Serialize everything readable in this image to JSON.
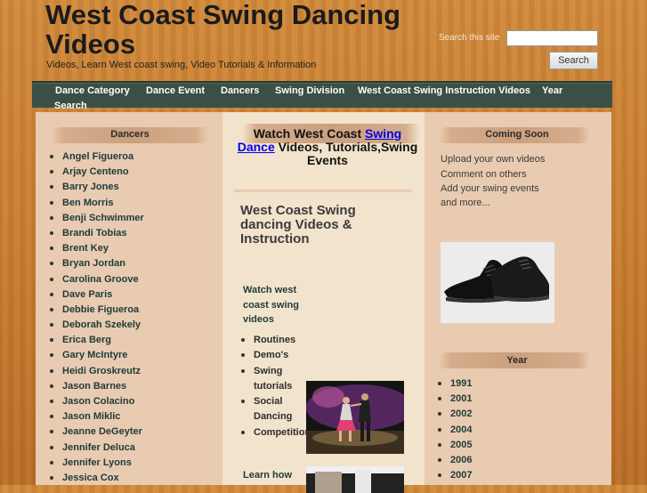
{
  "header": {
    "site_title": "West Coast Swing Dancing Videos",
    "tagline": "Videos, Learn West coast swing, Video Tutorials & Information",
    "search_label": "Search this site",
    "search_value": "",
    "search_button": "Search"
  },
  "nav": {
    "items": [
      "Dance Category",
      "Dance Event",
      "Dancers",
      "Swing Division",
      "West Coast Swing Instruction Videos",
      "Year",
      "Search"
    ]
  },
  "left_sidebar": {
    "heading": "Dancers",
    "dancers": [
      "Angel Figueroa",
      "Arjay Centeno",
      "Barry Jones",
      "Ben Morris",
      "Benji Schwimmer",
      "Brandi Tobias",
      "Brent Key",
      "Bryan Jordan",
      "Carolina Groove",
      "Dave Paris",
      "Debbie Figueroa",
      "Deborah Szekely",
      "Erica Berg",
      "Gary McIntyre",
      "Heidi Groskreutz",
      "Jason Barnes",
      "Jason Colacino",
      "Jason Miklic",
      "Jeanne DeGeyter",
      "Jennifer Deluca",
      "Jennifer Lyons",
      "Jessica Cox"
    ]
  },
  "main": {
    "heading_prefix": "Watch West Coast ",
    "heading_link": "Swing Dance",
    "heading_suffix": " Videos, Tutorials,Swing Events",
    "title": "West Coast Swing dancing Videos & Instruction",
    "sub_heading": "Watch west coast swing videos",
    "list": [
      "Routines",
      "Demo's",
      "Swing tutorials",
      "Social Dancing",
      "Competition"
    ],
    "learn_how": "Learn how"
  },
  "right_sidebar": {
    "coming_soon_heading": "Coming Soon",
    "coming_soon_lines": [
      "Upload your own videos",
      "Comment on others",
      "Add your swing events",
      "and more..."
    ],
    "year_heading": "Year",
    "years": [
      "1991",
      "2001",
      "2002",
      "2004",
      "2005",
      "2006",
      "2007"
    ]
  },
  "colors": {
    "nav_bg": "#3a5046",
    "link": "#0000ee",
    "sidebar_bg": "#e8cbb0",
    "content_bg": "#f2e3cc"
  }
}
